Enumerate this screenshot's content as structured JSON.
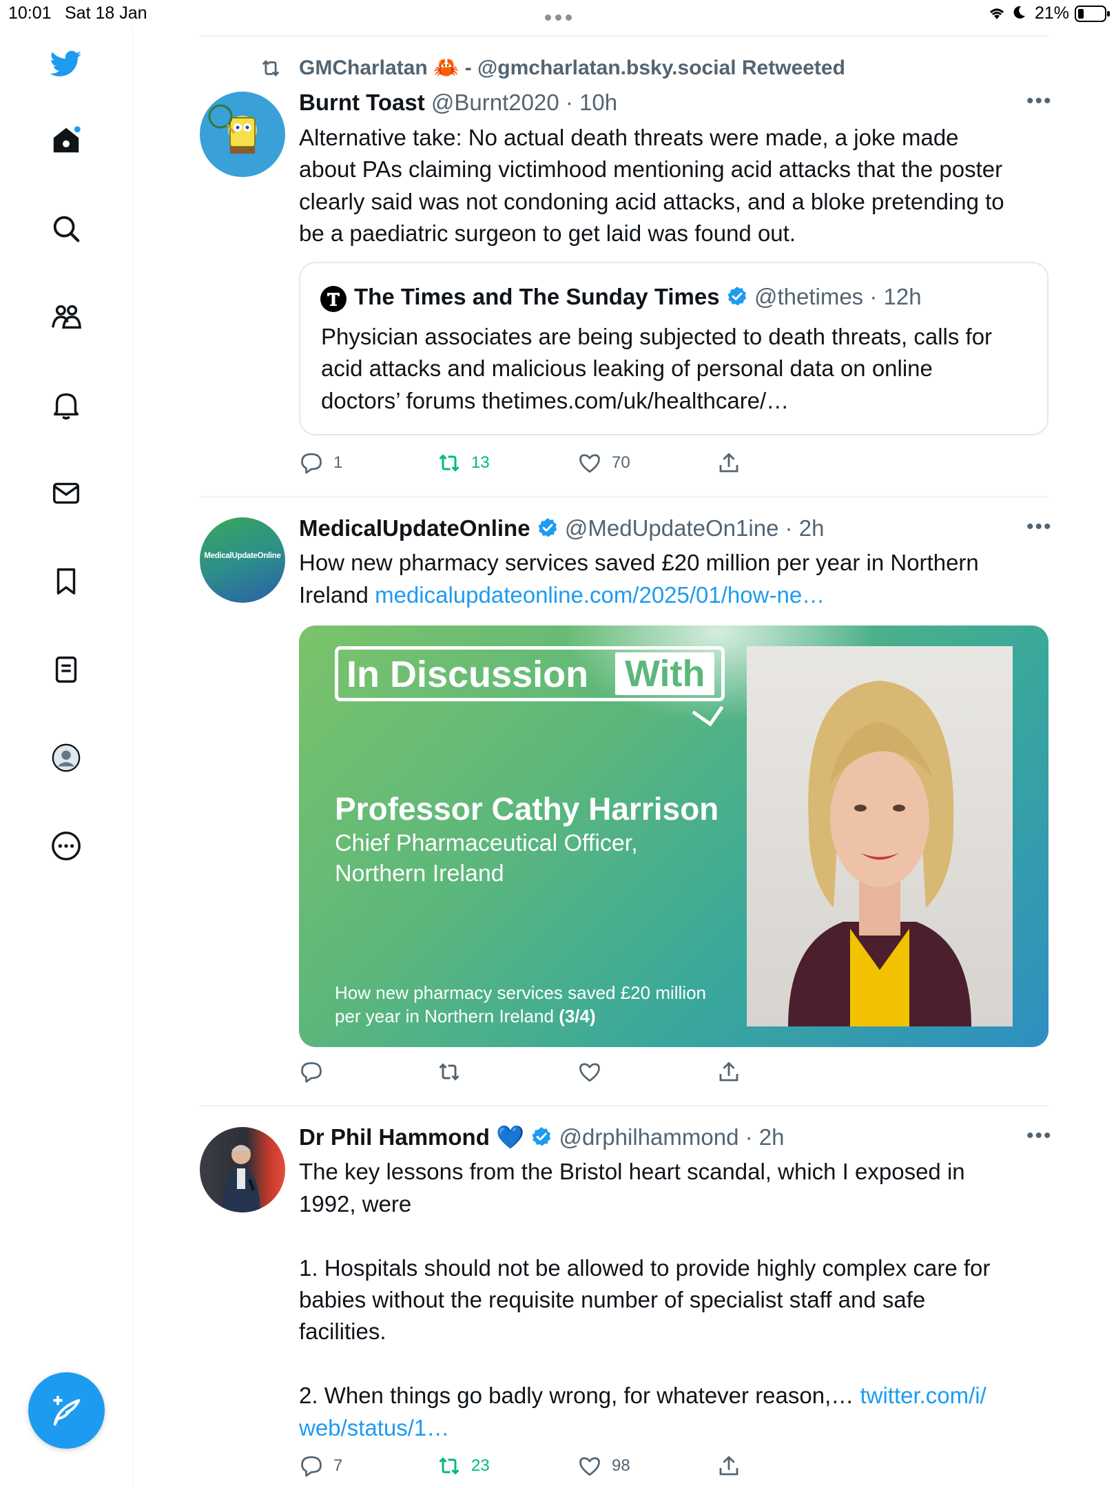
{
  "status_bar": {
    "time": "10:01",
    "date": "Sat 18 Jan",
    "battery": "21%"
  },
  "sidebar": {
    "items": [
      {
        "icon": "twitter-bird-icon"
      },
      {
        "icon": "home-icon"
      },
      {
        "icon": "search-icon"
      },
      {
        "icon": "communities-icon"
      },
      {
        "icon": "notifications-icon"
      },
      {
        "icon": "messages-icon"
      },
      {
        "icon": "bookmarks-icon"
      },
      {
        "icon": "lists-icon"
      },
      {
        "icon": "profile-icon"
      },
      {
        "icon": "more-icon"
      }
    ],
    "compose_icon": "compose-icon"
  },
  "colors": {
    "accent": "#1d9bf0",
    "retweet": "#00ba7c",
    "muted": "#536471"
  },
  "tweets": [
    {
      "social_context": "GMCharlatan 🦀 - @gmcharlatan.bsky.social Retweeted",
      "name": "Burnt Toast",
      "handle_time": "@Burnt2020 · 10h",
      "text_lines": [
        "Alternative take: No actual death threats were made, a joke made",
        "about PAs claiming victimhood mentioning acid attacks that the poster",
        "clearly said was not condoning acid attacks, and a bloke pretending to",
        "be a paediatric surgeon to get laid was found out."
      ],
      "quote": {
        "name": "The Times and The Sunday Times",
        "handle_time": "@thetimes · 12h",
        "text_lines": [
          "Physician associates are being subjected to death threats, calls for",
          "acid attacks and malicious leaking of personal data on online",
          "doctors’ forums thetimes.com/uk/healthcare/…"
        ]
      },
      "replies": "1",
      "retweets": "13",
      "likes": "70"
    },
    {
      "avatar_text": "MedicalUpdateOnline",
      "name": "MedicalUpdateOnline",
      "handle_time": "@MedUpdateOn1ine · 2h",
      "text_line1": "How new pharmacy services saved £20 million per year in Northern",
      "text_line2": "Ireland",
      "link": "medicalupdateonline.com/2025/01/how-ne…",
      "card": {
        "badge_left": "In Discussion",
        "badge_right": "With",
        "person": "Professor Cathy Harrison",
        "role_line1": "Chief Pharmaceutical Officer,",
        "role_line2": "Northern Ireland",
        "caption_line1": "How new pharmacy services saved £20 million",
        "caption_line2": "per year in Northern Ireland",
        "caption_suffix": "(3/4)"
      },
      "replies": "",
      "retweets": "",
      "likes": ""
    },
    {
      "name": "Dr Phil Hammond 💙",
      "handle_time": "@drphilhammond · 2h",
      "text_lines": [
        "The key lessons from the Bristol heart scandal, which I exposed in",
        "1992, were",
        "",
        "1. Hospitals should not be allowed to provide highly complex care for",
        "babies without the requisite number of specialist staff and safe",
        "facilities.",
        "",
        "2. When things go badly wrong, for whatever reason,…"
      ],
      "link_inline": "twitter.com/i/",
      "link_line2": "web/status/1…",
      "replies": "7",
      "retweets": "23",
      "likes": "98"
    }
  ]
}
